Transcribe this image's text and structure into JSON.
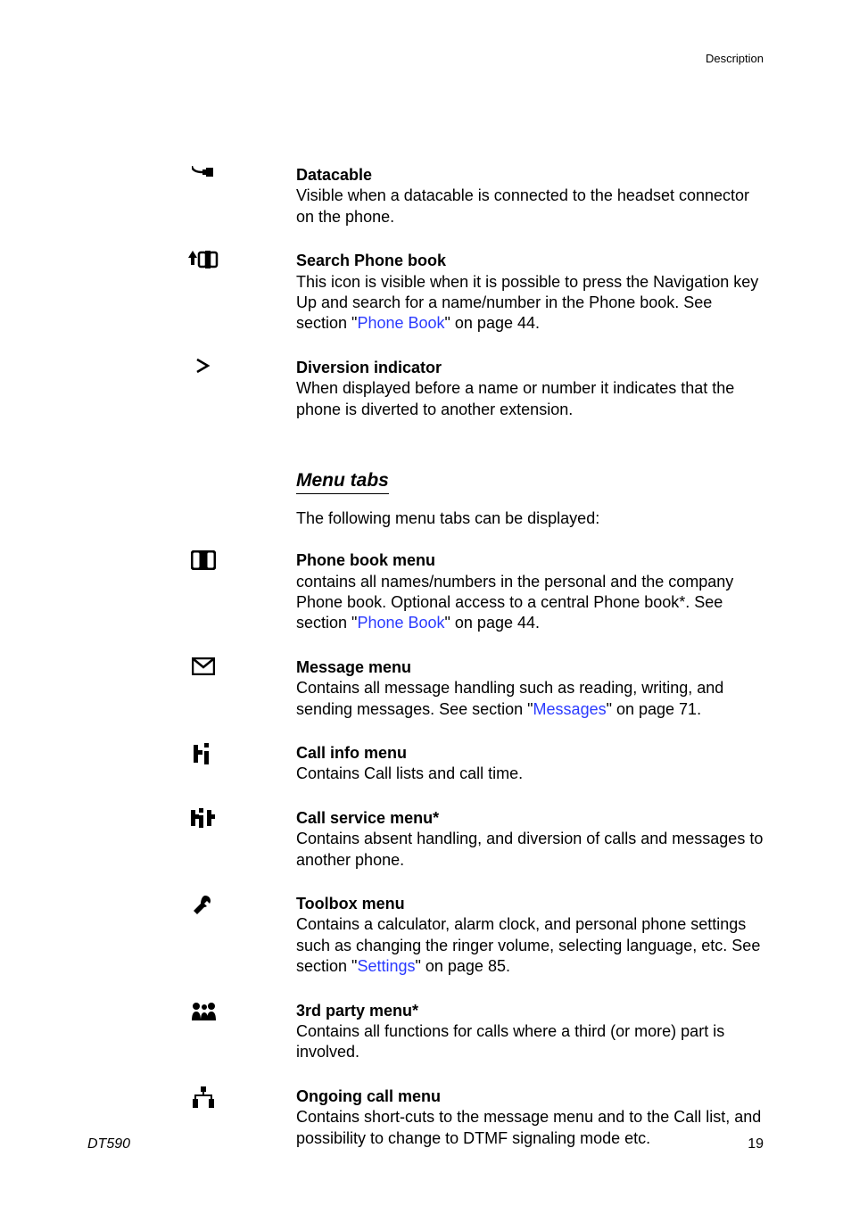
{
  "header": {
    "section_label": "Description"
  },
  "top_items": [
    {
      "icon": "datacable-icon",
      "title": "Datacable",
      "text": "Visible when a datacable is connected to the headset connector on the phone."
    },
    {
      "icon": "search-phonebook-icon",
      "title": "Search Phone book",
      "text_before": "This icon is visible when it is possible to press the Navigation key Up and search for a name/number in the Phone book. See section \"",
      "link": "Phone Book",
      "text_after": "\" on page 44."
    },
    {
      "icon": "diversion-indicator-icon",
      "title": "Diversion indicator",
      "text": "When displayed before a name or number it indicates that the phone is diverted to another extension."
    }
  ],
  "menu_tabs": {
    "heading": "Menu tabs",
    "preamble": "The following menu tabs can be displayed:",
    "items": [
      {
        "icon": "phonebook-menu-icon",
        "title": "Phone book menu",
        "text_before": "contains all names/numbers in the personal and the company Phone book. Optional access to a central Phone book*. See section \"",
        "link": "Phone Book",
        "text_after": "\" on page 44."
      },
      {
        "icon": "message-menu-icon",
        "title": "Message menu",
        "text_before": "Contains all message handling such as reading, writing, and sending messages. See section \"",
        "link": "Messages",
        "text_after": "\" on page 71."
      },
      {
        "icon": "call-info-menu-icon",
        "title": "Call info menu",
        "text": "Contains Call lists and call time."
      },
      {
        "icon": "call-service-menu-icon",
        "title": "Call service menu*",
        "text": "Contains absent handling, and diversion of calls and messages to another phone."
      },
      {
        "icon": "toolbox-menu-icon",
        "title": "Toolbox menu",
        "text_before": "Contains a calculator, alarm clock, and personal phone settings such as changing the ringer volume, selecting language, etc. See section \"",
        "link": "Settings",
        "text_after": "\" on page 85."
      },
      {
        "icon": "third-party-menu-icon",
        "title": "3rd party menu*",
        "text": "Contains all functions for calls where a third (or more) part is involved."
      },
      {
        "icon": "ongoing-call-menu-icon",
        "title": "Ongoing call menu",
        "text": "Contains short-cuts to the message menu and to the Call list, and possibility to change to DTMF signaling mode etc."
      }
    ]
  },
  "footer": {
    "left": "DT590",
    "right": "19"
  }
}
